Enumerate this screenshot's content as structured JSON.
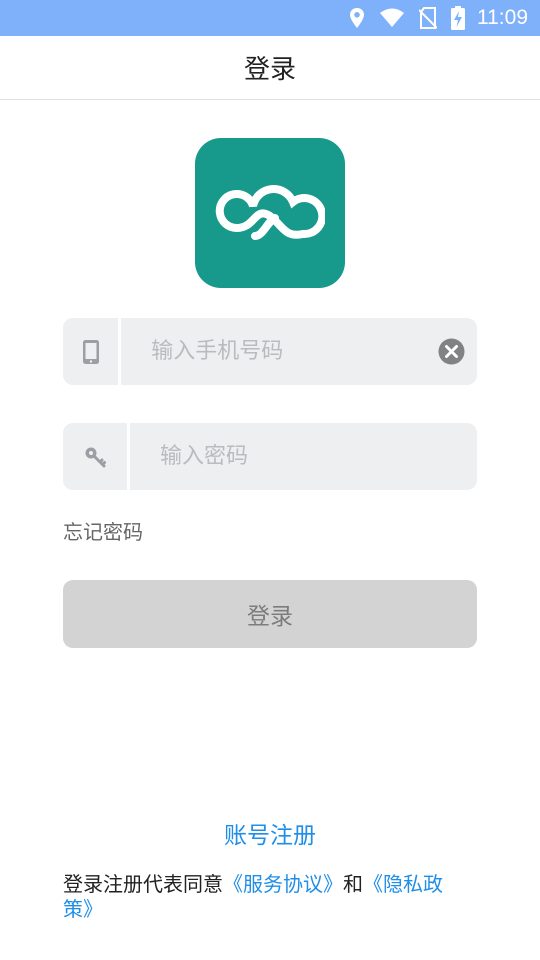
{
  "status_bar": {
    "time": "11:09",
    "icons": [
      "location-icon",
      "wifi-icon",
      "no-sim-icon",
      "battery-charging-icon"
    ]
  },
  "header": {
    "title": "登录"
  },
  "logo": {
    "icon": "cloud-logo-icon",
    "color": "#17998b"
  },
  "phone_field": {
    "icon": "phone-icon",
    "placeholder": "输入手机号码",
    "value": "",
    "clear_icon": "clear-icon"
  },
  "password_field": {
    "icon": "key-icon",
    "placeholder": "输入密码",
    "value": ""
  },
  "forgot_password": "忘记密码",
  "login_button": "登录",
  "register_link": "账号注册",
  "agreement": {
    "prefix": "登录注册代表同意",
    "service": "《服务协议》",
    "and": "和",
    "privacy": "《隐私政策》"
  },
  "colors": {
    "status_bar": "#7fb1fb",
    "accent": "#1f8ee8",
    "field_bg": "#eeeff1",
    "button_disabled": "#d3d3d3"
  }
}
